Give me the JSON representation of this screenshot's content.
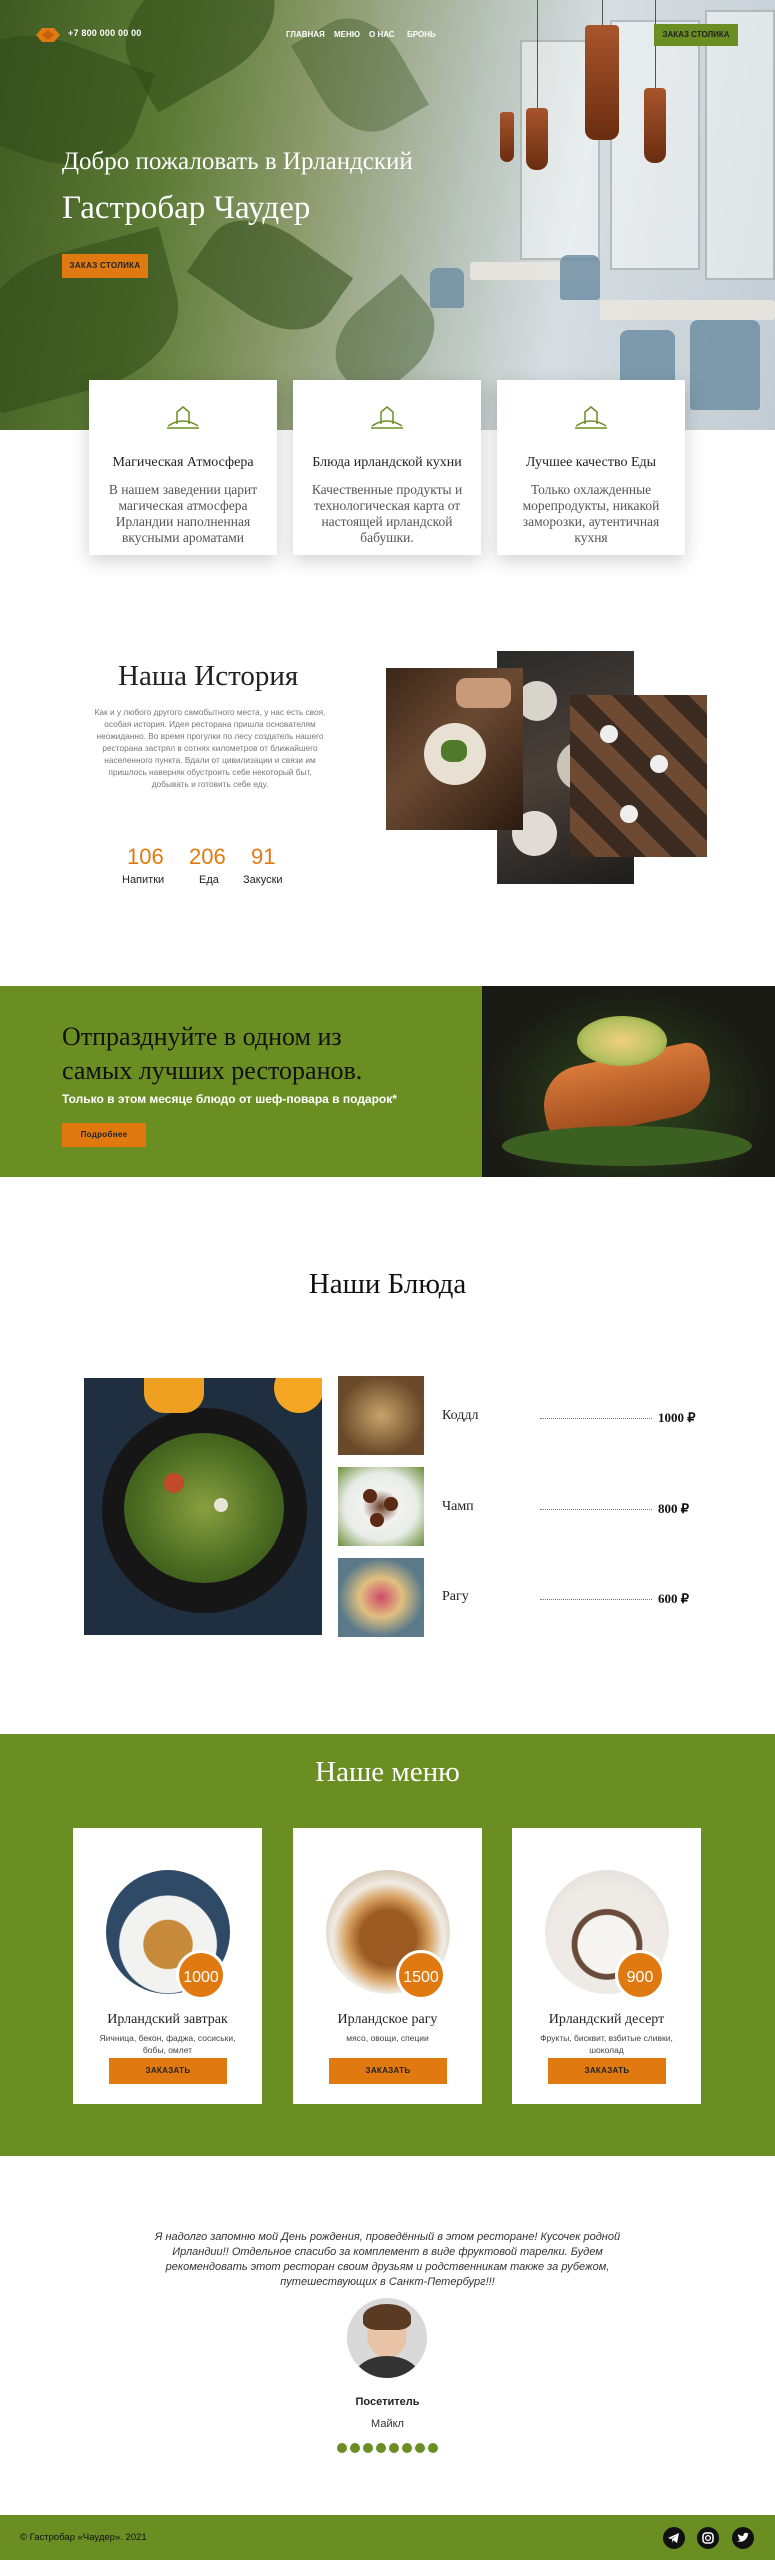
{
  "header": {
    "phone": "+7 800 000 00 00",
    "nav": [
      "ГЛАВНАЯ",
      "МЕНЮ",
      "О НАС",
      "БРОНЬ"
    ],
    "book_button": "ЗАКАЗ СТОЛИКА"
  },
  "hero": {
    "title_line1": "Добро пожаловать в Ирландский",
    "title_line2": "Гастробар Чаудер",
    "cta": "ЗАКАЗ СТОЛИКА"
  },
  "features": [
    {
      "title": "Магическая Атмосфера",
      "text": "В нашем заведении царит магическая атмосфера Ирландии наполненная вкусными ароматами"
    },
    {
      "title": "Блюда ирландской кухни",
      "text": "Качественные продукты и технологическая карта от настоящей ирландской бабушки."
    },
    {
      "title": "Лучшее качество Еды",
      "text": "Только охлажденные морепродукты, никакой заморозки, аутентичная кухня"
    }
  ],
  "story": {
    "title": "Наша История",
    "text": "Как и у любого другого самобытного места, у нас есть своя, особая история. Идея ресторана пришла основателям неожиданно. Во время прогулки по лесу создатель нашего ресторана застрял в сотнях километров от ближайшего населенного пункта. Вдали от цивилизации и связи им пришлось наверняк обустроить себе некоторый быт, добывать и готовить себе еду.",
    "stats": [
      {
        "value": "106",
        "label": "Напитки"
      },
      {
        "value": "206",
        "label": "Еда"
      },
      {
        "value": "91",
        "label": "Закуски"
      }
    ]
  },
  "promo": {
    "title_line1": "Отпразднуйте в одном из",
    "title_line2": "самых лучших ресторанов.",
    "subtitle": "Только в этом месяце блюдо от шеф-повара в подарок*",
    "button": "Подробнее"
  },
  "dishes": {
    "title": "Наши Блюда",
    "items": [
      {
        "name": "Коддл",
        "price": "1000 ₽"
      },
      {
        "name": "Чамп",
        "price": "800 ₽"
      },
      {
        "name": "Рагу",
        "price": "600 ₽"
      }
    ]
  },
  "menu": {
    "title": "Наше меню",
    "items": [
      {
        "price": "1000",
        "name": "Ирландский завтрак",
        "desc": "Яичница, бекон, фаджа, сосиськи, бобы, омлет",
        "button": "ЗАКАЗАТЬ"
      },
      {
        "price": "1500",
        "name": "Ирландское рагу",
        "desc": "мясо, овощи, специи",
        "button": "ЗАКАЗАТЬ"
      },
      {
        "price": "900",
        "name": "Ирландский десерт",
        "desc": "Фрукты, бисквит, взбитые сливки, шоколад",
        "button": "ЗАКАЗАТЬ"
      }
    ]
  },
  "testimonial": {
    "quote": "Я надолго запомню мой День рождения, проведённый в этом ресторане! Кусочек родной Ирландии!! Отдельное спасибо за комплемент в виде фруктовой тарелки. Будем рекомендовать этот ресторан своим друзьям и родственникам также за рубежом, путешествующих в Санкт-Петербург!!!",
    "role": "Посетитель",
    "name": "Майкл"
  },
  "footer": {
    "copyright": "© Гастробар «Чаудер». 2021"
  },
  "colors": {
    "accent": "#e07a10",
    "brand_green": "#6b8e23"
  },
  "icons": [
    "logo-icon",
    "farm-icon",
    "telegram-icon",
    "instagram-icon",
    "twitter-icon"
  ]
}
